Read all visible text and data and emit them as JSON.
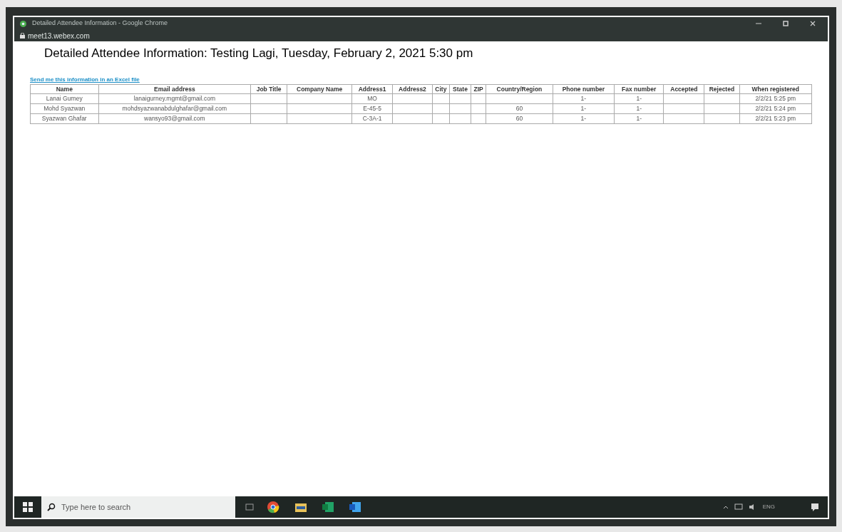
{
  "window": {
    "title": "Detailed Attendee Information - Google Chrome",
    "address": "meet13.webex.com"
  },
  "page": {
    "heading": "Detailed Attendee Information:  Testing Lagi, Tuesday, February 2, 2021 5:30 pm",
    "excel_link": "Send me this information in an Excel file"
  },
  "table": {
    "columns": [
      "Name",
      "Email address",
      "Job Title",
      "Company Name",
      "Address1",
      "Address2",
      "City",
      "State",
      "ZIP",
      "Country/Region",
      "Phone number",
      "Fax number",
      "Accepted",
      "Rejected",
      "When registered"
    ],
    "rows": [
      [
        "Lanai Gurney",
        "lanaigurney.mgmt@gmail.com",
        "",
        "",
        "MO",
        "",
        "",
        "",
        "",
        "",
        "1-",
        "1-",
        "",
        "",
        "2/2/21 5:25 pm"
      ],
      [
        "Mohd Syazwan",
        "mohdsyazwanabdulghafar@gmail.com",
        "",
        "",
        "E-45-5",
        "",
        "",
        "",
        "",
        "60",
        "1-",
        "1-",
        "",
        "",
        "2/2/21 5:24 pm"
      ],
      [
        "Syazwan Ghafar",
        "wansyo93@gmail.com",
        "",
        "",
        "C-3A-1",
        "",
        "",
        "",
        "",
        "60",
        "1-",
        "1-",
        "",
        "",
        "2/2/21 5:23 pm"
      ]
    ]
  },
  "taskbar": {
    "search_placeholder": "Type here to search",
    "language": "ENG"
  }
}
